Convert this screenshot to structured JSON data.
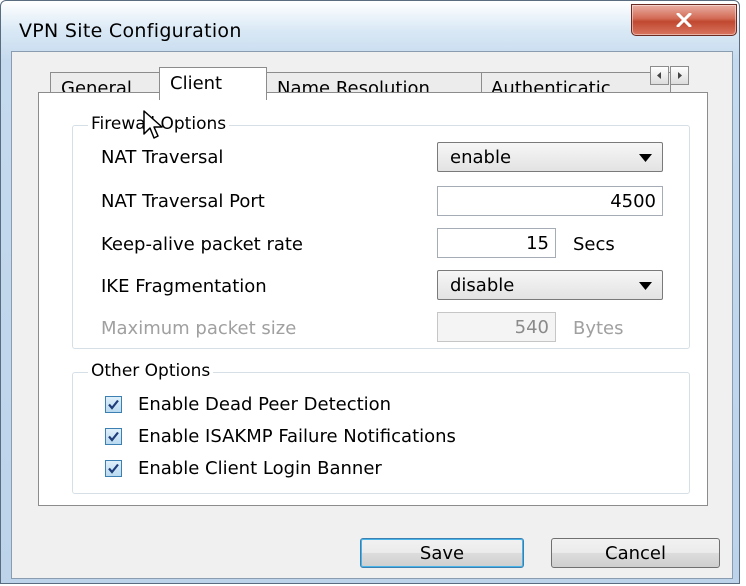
{
  "window": {
    "title": "VPN Site Configuration"
  },
  "tabs": [
    {
      "label": "General",
      "active": false
    },
    {
      "label": "Client",
      "active": true
    },
    {
      "label": "Name Resolution",
      "active": false
    },
    {
      "label": "Authenticatic",
      "active": false
    }
  ],
  "firewall": {
    "legend": "Firewall Options",
    "nat_traversal": {
      "label": "NAT Traversal",
      "value": "enable"
    },
    "nat_traversal_port": {
      "label": "NAT Traversal Port",
      "value": "4500"
    },
    "keepalive": {
      "label": "Keep-alive packet rate",
      "value": "15",
      "unit": "Secs"
    },
    "ike_fragmentation": {
      "label": "IKE Fragmentation",
      "value": "disable"
    },
    "max_packet_size": {
      "label": "Maximum packet size",
      "value": "540",
      "unit": "Bytes",
      "disabled": true
    }
  },
  "other": {
    "legend": "Other Options",
    "items": [
      {
        "label": "Enable Dead Peer Detection",
        "checked": true
      },
      {
        "label": "Enable ISAKMP Failure Notifications",
        "checked": true
      },
      {
        "label": "Enable Client Login Banner",
        "checked": true
      }
    ]
  },
  "buttons": {
    "save": "Save",
    "cancel": "Cancel"
  },
  "icons": {
    "close": "close-icon",
    "scroll_left": "arrow-left-icon",
    "scroll_right": "arrow-right-icon",
    "dropdown": "chevron-down-icon",
    "check": "check-icon",
    "cursor": "mouse-cursor-icon"
  },
  "colors": {
    "close_button": "#c9543e",
    "checkbox_border": "#3c7fb1",
    "default_button_glow": "#48b4e8"
  }
}
